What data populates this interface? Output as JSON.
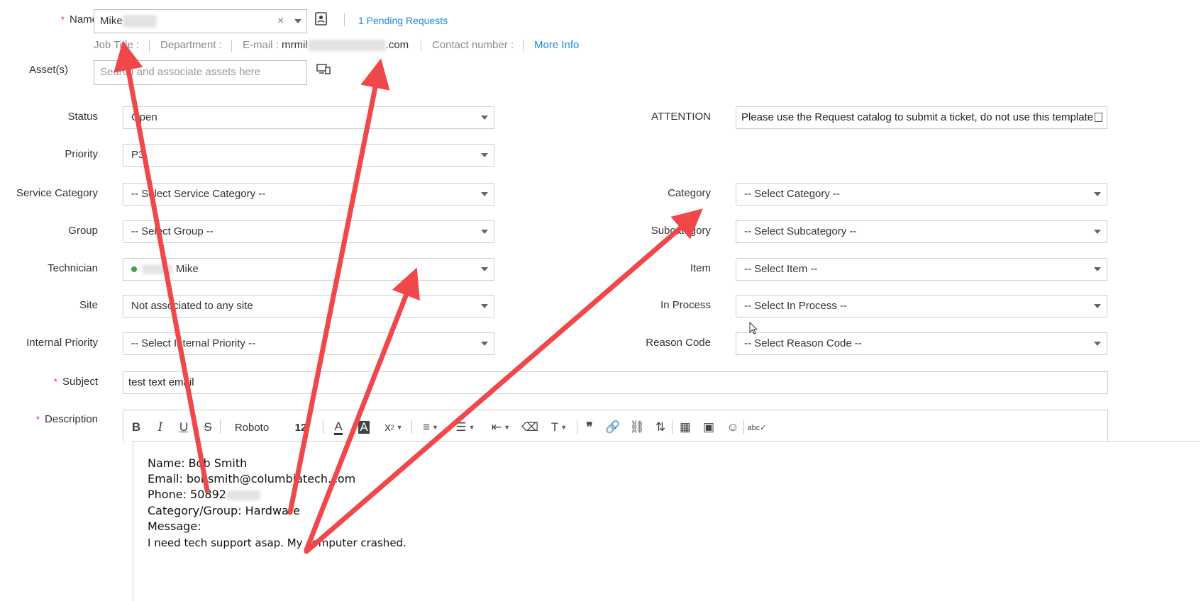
{
  "requester": {
    "name_label": "Name",
    "name_value": "Mike",
    "pending_requests": "1 Pending Requests",
    "info": {
      "job_title": "Job Title :",
      "department": "Department :",
      "email_label": "E-mail :",
      "email_start": "mrmil",
      "email_end": ".com",
      "contact": "Contact number :",
      "more_info": "More Info"
    }
  },
  "assets": {
    "label": "Asset(s)",
    "placeholder": "Search and associate assets here"
  },
  "left_fields": [
    {
      "label": "Status",
      "value": "Open"
    },
    {
      "label": "Priority",
      "value": "P3"
    },
    {
      "label": "Service Category",
      "value": "-- Select Service Category --"
    },
    {
      "label": "Group",
      "value": "-- Select Group --"
    },
    {
      "label": "Technician",
      "value": "Mike"
    },
    {
      "label": "Site",
      "value": "Not associated to any site"
    },
    {
      "label": "Internal Priority",
      "value": "-- Select Internal Priority --"
    }
  ],
  "right_fields": [
    {
      "label": "ATTENTION",
      "value": "Please use the Request catalog to submit a ticket, do not use this template"
    },
    {
      "label": "Category",
      "value": "-- Select Category --"
    },
    {
      "label": "Subcategory",
      "value": "-- Select Subcategory --"
    },
    {
      "label": "Item",
      "value": "-- Select Item --"
    },
    {
      "label": "In Process",
      "value": "-- Select In Process --"
    },
    {
      "label": "Reason Code",
      "value": "-- Select Reason Code --"
    }
  ],
  "subject": {
    "label": "Subject",
    "value": "test text email"
  },
  "description": {
    "label": "Description",
    "toolbar": {
      "font": "Roboto",
      "size": "12"
    },
    "lines": [
      "Name: Bob Smith",
      "Email: bobsmith@columbiatech.com",
      "Phone: 50892",
      "Category/Group: Hardware",
      "Message:",
      "I need tech support asap. My computer crashed."
    ]
  },
  "colors": {
    "required": "#e53935",
    "link": "#1e88e5",
    "arrow": "#f0474b",
    "status_online": "#43a047"
  }
}
